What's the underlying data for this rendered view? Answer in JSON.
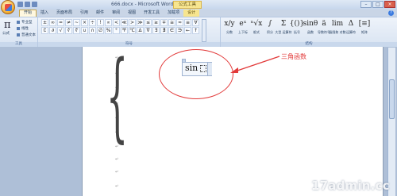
{
  "window": {
    "title": "666.docx - Microsoft Word",
    "context_tab": "公式工具",
    "controls": [
      "–",
      "□",
      "×"
    ]
  },
  "tabs": [
    "开始",
    "插入",
    "页面布局",
    "引用",
    "邮件",
    "审阅",
    "视图",
    "开发工具",
    "加载项",
    "设计"
  ],
  "ribbon": {
    "tools": {
      "pi_symbol": "π",
      "pi_label": "公式",
      "options": [
        "专业型",
        "线性",
        "普通文本"
      ],
      "group_label": "工具"
    },
    "symbols": {
      "row1": [
        "±",
        "∞",
        "=",
        "≠",
        "~",
        "×",
        "÷",
        "!",
        "∝",
        "<",
        "≪",
        ">",
        "≫",
        "≤",
        "≥",
        "∓",
        "≅",
        "≈",
        "≡",
        "∀"
      ],
      "row2": [
        "∁",
        "∂",
        "√",
        "∛",
        "∜",
        "∪",
        "∩",
        "∅",
        "%",
        "°",
        "℉",
        "℃",
        "∆",
        "∇",
        "∃",
        "∄",
        "∈",
        "∋",
        "←",
        "↑"
      ],
      "group_label": "符号"
    },
    "structures": {
      "items": [
        {
          "glyph": "x/y",
          "label": "分数"
        },
        {
          "glyph": "eˣ",
          "label": "上下标"
        },
        {
          "glyph": "ⁿ√x",
          "label": "根式"
        },
        {
          "glyph": "∫",
          "label": "积分"
        },
        {
          "glyph": "Σ",
          "label": "大型\n运算符"
        },
        {
          "glyph": "{()}",
          "label": "括号"
        },
        {
          "glyph": "sinθ",
          "label": "函数"
        },
        {
          "glyph": "ä",
          "label": "导数符号"
        },
        {
          "glyph": "lim",
          "label": "极限和\n对数"
        },
        {
          "glyph": "Δ",
          "label": "运算符"
        },
        {
          "glyph": "[≡]",
          "label": "矩阵"
        }
      ],
      "group_label": "结构"
    }
  },
  "document": {
    "equation_text": "sin",
    "annotation": "三角函数",
    "paragraph_mark": "↵"
  },
  "watermark": "17admin.cc"
}
